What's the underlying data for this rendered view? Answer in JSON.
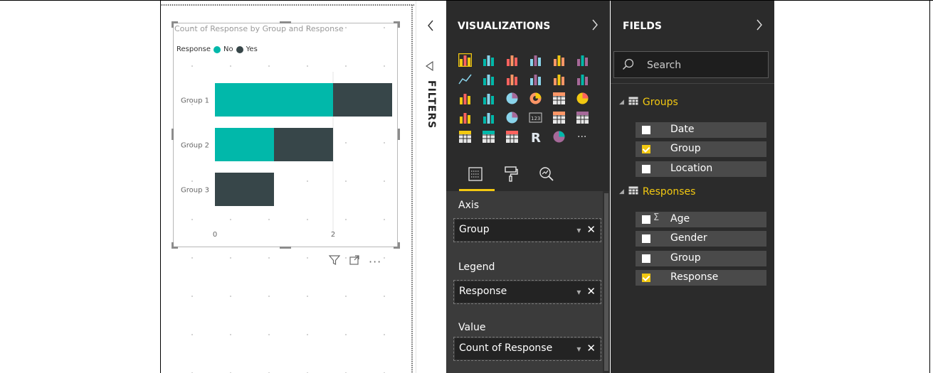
{
  "visual": {
    "title": "Count of Response by Group and Response",
    "legend": {
      "label": "Response",
      "items": [
        {
          "name": "No",
          "color": "#01b8aa"
        },
        {
          "name": "Yes",
          "color": "#374649"
        }
      ]
    }
  },
  "chart_data": {
    "type": "bar",
    "orientation": "horizontal",
    "stacked": true,
    "title": "Count of Response by Group and Response",
    "categories": [
      "Group 1",
      "Group 2",
      "Group 3"
    ],
    "series": [
      {
        "name": "No",
        "values": [
          2,
          1,
          0
        ],
        "color": "#01b8aa"
      },
      {
        "name": "Yes",
        "values": [
          1,
          1,
          1
        ],
        "color": "#374649"
      }
    ],
    "x_ticks": [
      "0",
      "2"
    ],
    "xlim": [
      0,
      3
    ],
    "legend_position": "top-left",
    "grid": true
  },
  "filters": {
    "label": "FILTERS"
  },
  "visualizations": {
    "title": "VISUALIZATIONS",
    "gallery_icons": [
      "stacked-bar-icon",
      "stacked-column-icon",
      "clustered-bar-icon",
      "clustered-column-icon",
      "100-bar-icon",
      "100-column-icon",
      "line-chart-icon",
      "area-chart-icon",
      "stacked-area-icon",
      "line-column-icon",
      "line-clustered-icon",
      "ribbon-chart-icon",
      "waterfall-icon",
      "scatter-icon",
      "pie-chart-icon",
      "donut-chart-icon",
      "treemap-icon",
      "map-icon",
      "filled-map-icon",
      "funnel-icon",
      "gauge-icon",
      "card-icon",
      "multirow-card-icon",
      "kpi-icon",
      "slicer-icon",
      "table-icon",
      "matrix-icon",
      "r-visual-icon",
      "arcgis-icon",
      "more-icon"
    ],
    "wells": [
      {
        "label": "Axis",
        "field": "Group"
      },
      {
        "label": "Legend",
        "field": "Response"
      },
      {
        "label": "Value",
        "field": "Count of Response"
      }
    ]
  },
  "fields": {
    "title": "FIELDS",
    "search_placeholder": "Search",
    "tables": [
      {
        "name": "Groups",
        "fields": [
          {
            "name": "Date",
            "checked": false,
            "sigma": false
          },
          {
            "name": "Group",
            "checked": true,
            "sigma": false
          },
          {
            "name": "Location",
            "checked": false,
            "sigma": false
          }
        ]
      },
      {
        "name": "Responses",
        "fields": [
          {
            "name": "Age",
            "checked": false,
            "sigma": true
          },
          {
            "name": "Gender",
            "checked": false,
            "sigma": false
          },
          {
            "name": "Group",
            "checked": false,
            "sigma": false
          },
          {
            "name": "Response",
            "checked": true,
            "sigma": false
          }
        ]
      }
    ]
  },
  "colors": {
    "accent": "#f2c811",
    "pane_dark": "#2b2b2b",
    "pane_mid": "#3b3b3b"
  }
}
